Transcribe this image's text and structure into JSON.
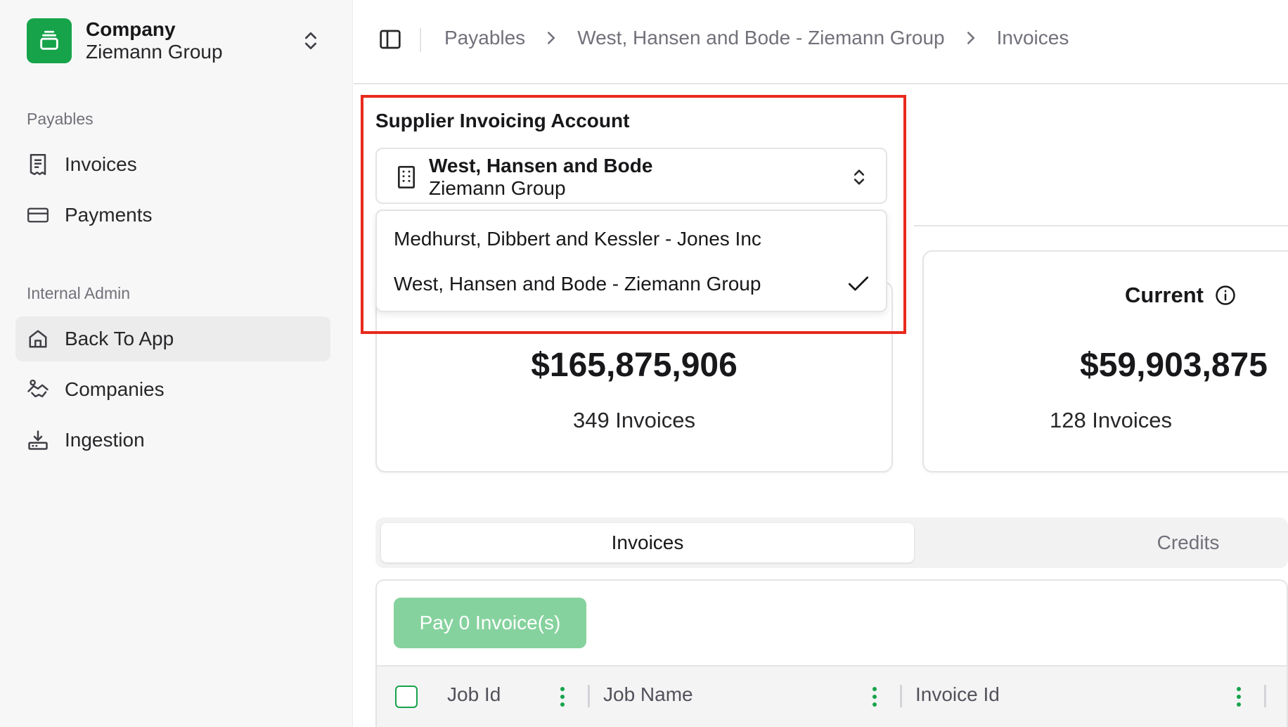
{
  "sidebar": {
    "company": {
      "title": "Company",
      "name": "Ziemann Group"
    },
    "sections": [
      {
        "label": "Payables",
        "items": [
          {
            "label": "Invoices"
          },
          {
            "label": "Payments"
          }
        ]
      },
      {
        "label": "Internal Admin",
        "items": [
          {
            "label": "Back To App",
            "active": true
          },
          {
            "label": "Companies"
          },
          {
            "label": "Ingestion"
          }
        ]
      }
    ]
  },
  "breadcrumb": [
    "Payables",
    "West, Hansen and Bode - Ziemann Group",
    "Invoices"
  ],
  "supplier_select": {
    "label": "Supplier Invoicing Account",
    "selected_line1": "West, Hansen and Bode",
    "selected_line2": "Ziemann Group",
    "options": [
      {
        "label": "Medhurst, Dibbert and Kessler - Jones Inc",
        "selected": false
      },
      {
        "label": "West, Hansen and Bode - Ziemann Group",
        "selected": true
      }
    ]
  },
  "summary": {
    "total": {
      "amount": "$165,875,906",
      "count": "349 Invoices"
    },
    "current": {
      "title": "Current",
      "amount": "$59,903,875",
      "count": "128 Invoices"
    }
  },
  "tabs": [
    {
      "label": "Invoices",
      "active": true
    },
    {
      "label": "Credits",
      "active": false
    }
  ],
  "table": {
    "pay_button": "Pay 0 Invoice(s)",
    "columns": [
      "Job Id",
      "Job Name",
      "Invoice Id"
    ]
  },
  "colors": {
    "brand": "#16a34a",
    "highlight": "#e8291c",
    "pay_disabled": "#86d29e"
  }
}
